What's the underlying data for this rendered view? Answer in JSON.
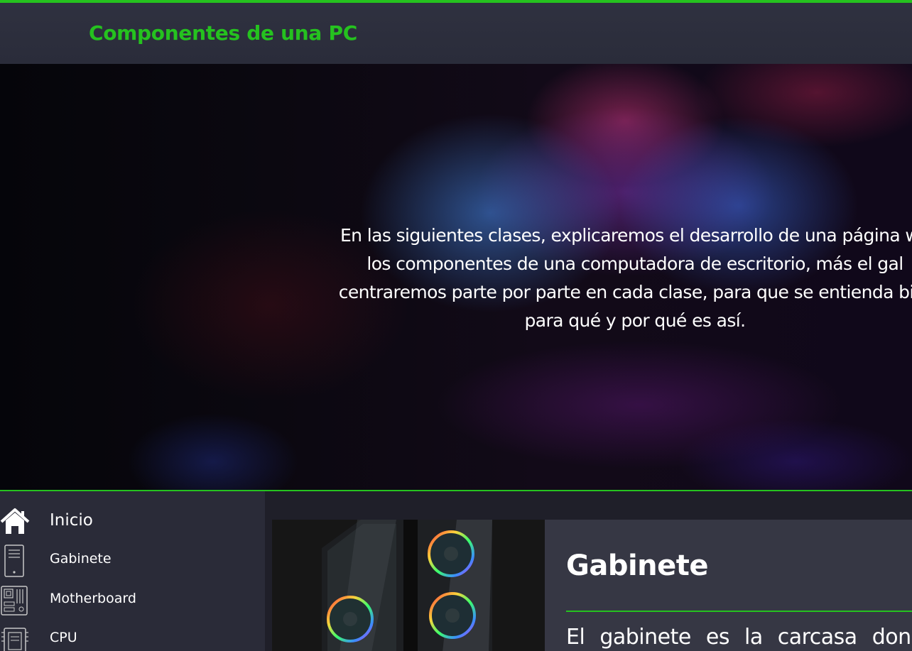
{
  "header": {
    "title": "Componentes de una PC",
    "accent_color": "#25c21f"
  },
  "hero": {
    "lines": [
      "En las siguientes clases, explicaremos el desarrollo de una página we",
      "los componentes de una computadora de escritorio, más el gal",
      "centraremos parte por parte en cada clase, para que se entienda bier",
      "para qué y por qué es así."
    ]
  },
  "sidebar": {
    "items": [
      {
        "label": "Inicio",
        "icon": "home-icon"
      },
      {
        "label": "Gabinete",
        "icon": "pc-tower-icon"
      },
      {
        "label": "Motherboard",
        "icon": "motherboard-icon"
      },
      {
        "label": "CPU",
        "icon": "cpu-icon"
      }
    ]
  },
  "card": {
    "title": "Gabinete",
    "text": "El gabinete es la carcasa donde",
    "image": "pc-case-image"
  }
}
